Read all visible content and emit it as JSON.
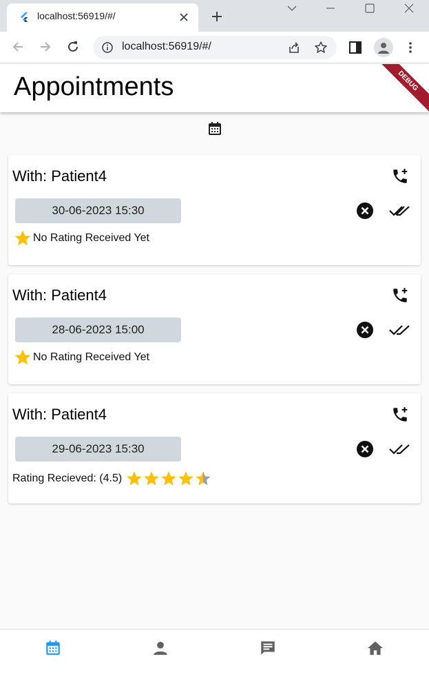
{
  "browser": {
    "tab_title": "localhost:56919/#/",
    "url": "localhost:56919/#/"
  },
  "app": {
    "title": "Appointments",
    "debug_label": "DEBUG"
  },
  "appointments": [
    {
      "with": "With: Patient4",
      "datetime": "30-06-2023 15:30",
      "rating_text": "No Rating Received Yet",
      "rating": null
    },
    {
      "with": "With: Patient4",
      "datetime": "28-06-2023 15:00",
      "rating_text": "No Rating Received Yet",
      "rating": null
    },
    {
      "with": "With: Patient4",
      "datetime": "29-06-2023 15:30",
      "rating_text": "Rating Recieved: (4.5)",
      "rating": 4.5
    }
  ],
  "bottom_nav": [
    {
      "name": "appointments",
      "icon": "calendar-icon",
      "active": true
    },
    {
      "name": "profile",
      "icon": "person-icon",
      "active": false
    },
    {
      "name": "messages",
      "icon": "chat-icon",
      "active": false
    },
    {
      "name": "home",
      "icon": "home-icon",
      "active": false
    }
  ],
  "colors": {
    "accent": "#2196f3",
    "star": "#ffc107",
    "date_box": "#cfd8dc",
    "debug": "#a11c2c",
    "inactive_icon": "#616161"
  }
}
